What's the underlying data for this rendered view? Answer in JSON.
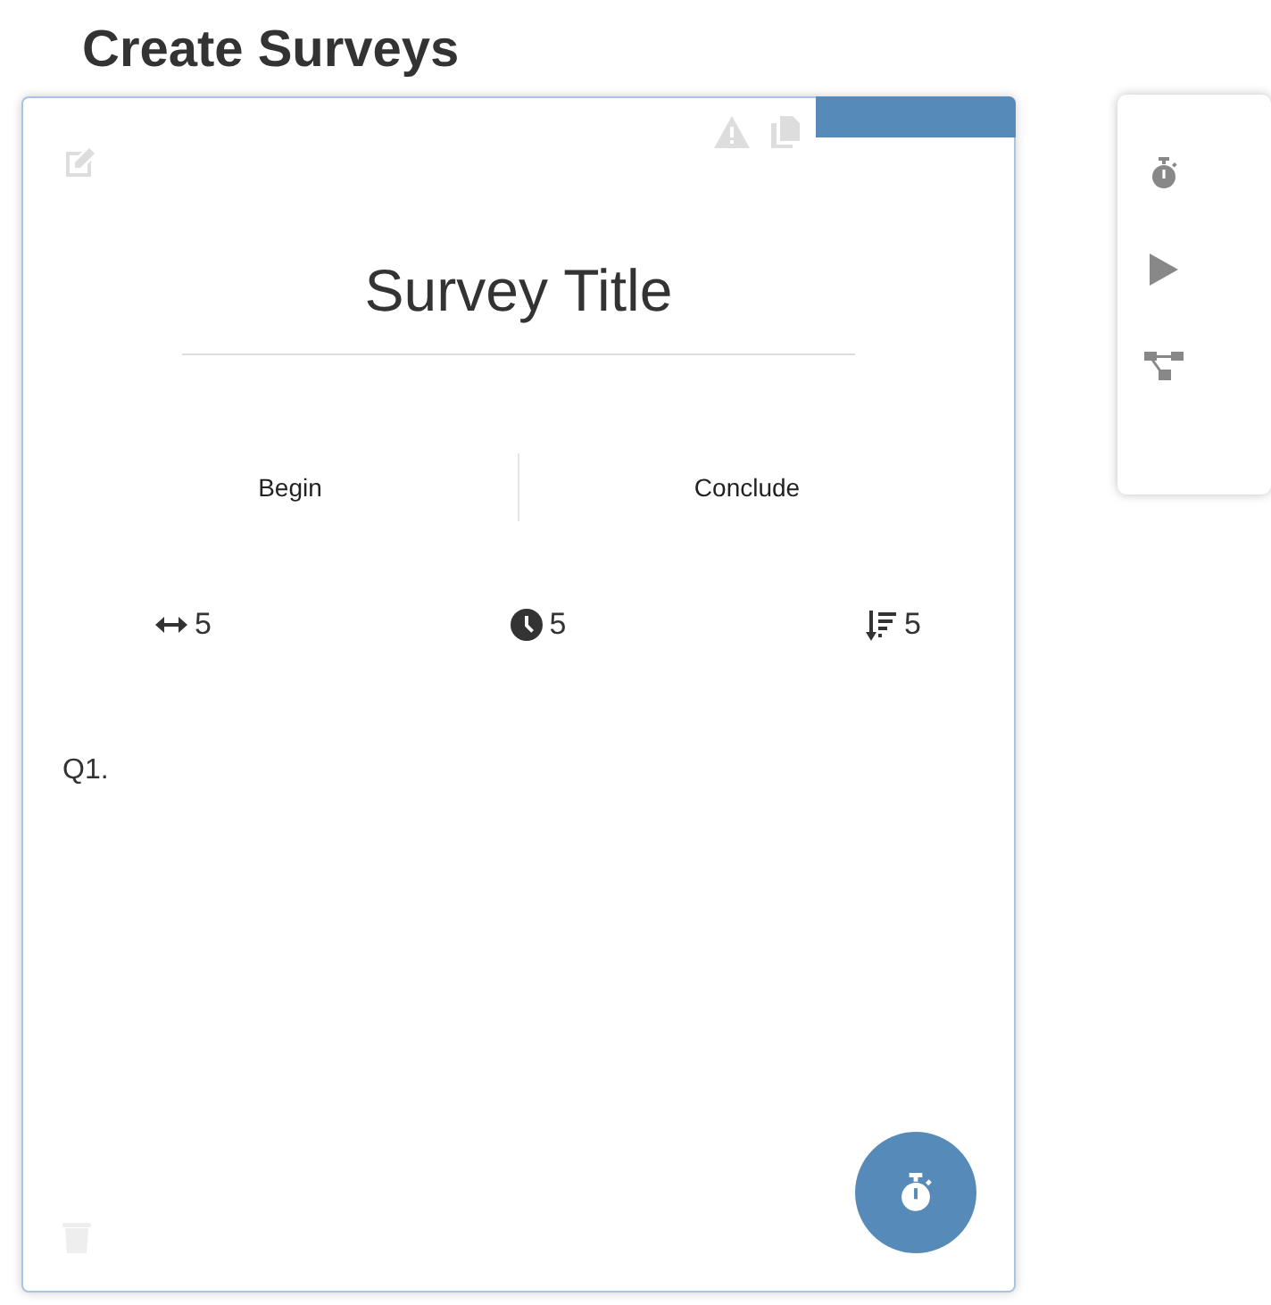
{
  "page": {
    "title": "Create Surveys"
  },
  "survey": {
    "title": "Survey Title",
    "sections": [
      "Begin",
      "Conclude"
    ],
    "stats": [
      {
        "kind": "width",
        "value": "5"
      },
      {
        "kind": "time",
        "value": "5"
      },
      {
        "kind": "order",
        "value": "5"
      }
    ],
    "questions": [
      {
        "label": "Q1."
      }
    ]
  }
}
